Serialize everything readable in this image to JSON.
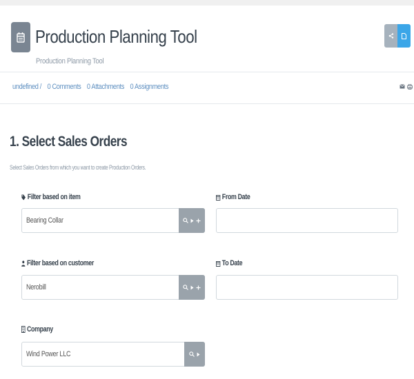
{
  "header": {
    "title": "Production Planning Tool",
    "subtitle": "Production Planning Tool",
    "app_icon": "calendar-icon",
    "share_icon": "share-icon",
    "doc_icon": "document-icon"
  },
  "meta": {
    "links": [
      "undefined /",
      "0 Comments",
      "0 Attachments",
      "0 Assignments"
    ],
    "icons": [
      "email-icon",
      "print-icon"
    ]
  },
  "section": {
    "title": "1. Select Sales Orders",
    "description": "Select Sales Orders from which you want to create Production Orders."
  },
  "fields": {
    "item": {
      "label": "Filter based on item",
      "value": "Bearing Collar",
      "icon": "tag-icon"
    },
    "from_date": {
      "label": "From Date",
      "value": "",
      "icon": "calendar-icon"
    },
    "customer": {
      "label": "Filter based on customer",
      "value": "Nerobill",
      "icon": "user-icon"
    },
    "to_date": {
      "label": "To Date",
      "value": "",
      "icon": "calendar-icon"
    },
    "company": {
      "label": "Company",
      "value": "Wind Power LLC",
      "icon": "building-icon"
    }
  },
  "colors": {
    "accent": "#3ba6e8",
    "link": "#5e8fc0",
    "addon": "#9aa3ab",
    "icon_bg": "#7a8592"
  }
}
